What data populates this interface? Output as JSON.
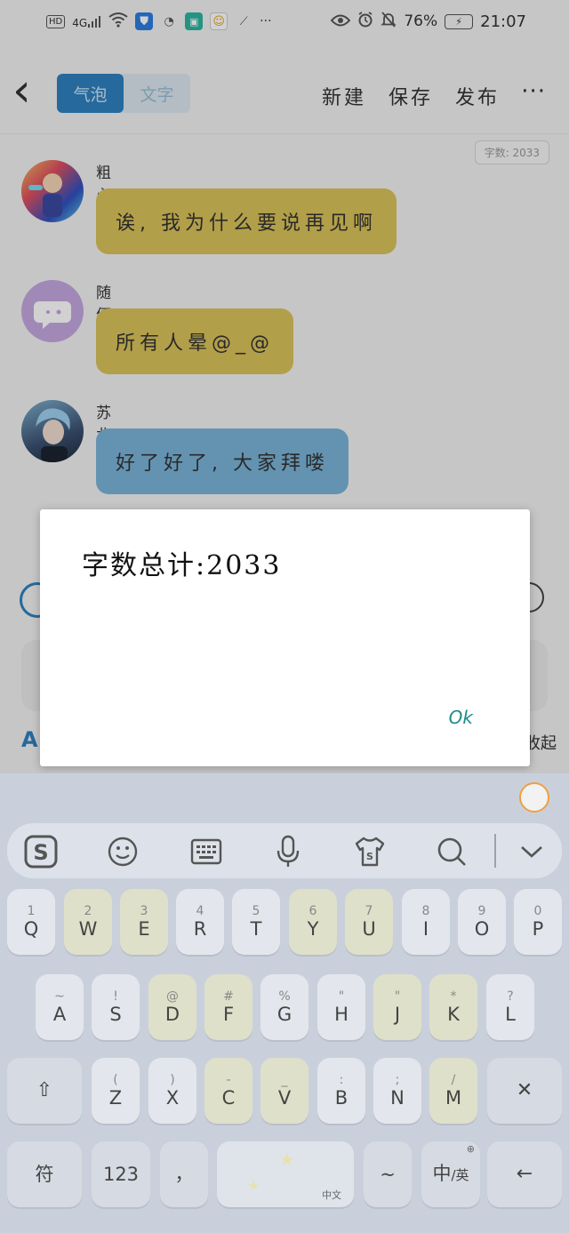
{
  "status_bar": {
    "left_chips": [
      "HD",
      "4G"
    ],
    "more_dots": "···",
    "battery_percent": "76%",
    "time": "21:07"
  },
  "topbar": {
    "back_glyph": "‹",
    "tabs": [
      {
        "label": "气泡",
        "active": true
      },
      {
        "label": "文字",
        "active": false
      }
    ],
    "actions": [
      "新建",
      "保存",
      "发布"
    ],
    "more_glyph": "···"
  },
  "word_count_tag": "字数: 2033",
  "messages": [
    {
      "sender": "粗心超人",
      "text": "诶, 我为什么要说再见啊",
      "bubble_color": "#d9c259"
    },
    {
      "sender": "随便谁",
      "text": "所有人晕@_@",
      "bubble_color": "#d9c259"
    },
    {
      "sender": "苏北",
      "text": "好了好了, 大家拜喽",
      "bubble_color": "#7ab4d8"
    }
  ],
  "under_panel": {
    "a_label": "A",
    "collapse_label": "收起"
  },
  "dialog": {
    "message": "字数总计:2033",
    "ok_label": "Ok"
  },
  "keyboard": {
    "toolbar_icons": [
      "sogou-logo-icon",
      "emoji-icon",
      "keyboard-icon",
      "microphone-icon",
      "skin-icon",
      "search-icon",
      "chevron-down-icon"
    ],
    "row1": [
      {
        "sub": "1",
        "main": "Q"
      },
      {
        "sub": "2",
        "main": "W"
      },
      {
        "sub": "3",
        "main": "E"
      },
      {
        "sub": "4",
        "main": "R"
      },
      {
        "sub": "5",
        "main": "T"
      },
      {
        "sub": "6",
        "main": "Y"
      },
      {
        "sub": "7",
        "main": "U"
      },
      {
        "sub": "8",
        "main": "I"
      },
      {
        "sub": "9",
        "main": "O"
      },
      {
        "sub": "0",
        "main": "P"
      }
    ],
    "row2": [
      {
        "sub": "~",
        "main": "A"
      },
      {
        "sub": "!",
        "main": "S"
      },
      {
        "sub": "@",
        "main": "D"
      },
      {
        "sub": "#",
        "main": "F"
      },
      {
        "sub": "%",
        "main": "G"
      },
      {
        "sub": "\"",
        "main": "H"
      },
      {
        "sub": "\"",
        "main": "J"
      },
      {
        "sub": "*",
        "main": "K"
      },
      {
        "sub": "?",
        "main": "L"
      }
    ],
    "row3": [
      {
        "sub": "(",
        "main": "Z"
      },
      {
        "sub": ")",
        "main": "X"
      },
      {
        "sub": "-",
        "main": "C"
      },
      {
        "sub": "_",
        "main": "V"
      },
      {
        "sub": ":",
        "main": "B"
      },
      {
        "sub": ";",
        "main": "N"
      },
      {
        "sub": "/",
        "main": "M"
      }
    ],
    "shift_glyph": "⇧",
    "delete_glyph": "✕",
    "bottom": {
      "symbols": "符",
      "numbers": "123",
      "comma": "，",
      "space_label": "中文",
      "tilde": "~",
      "lang_main": "中",
      "lang_sub": "/英",
      "enter_glyph": "←"
    }
  }
}
